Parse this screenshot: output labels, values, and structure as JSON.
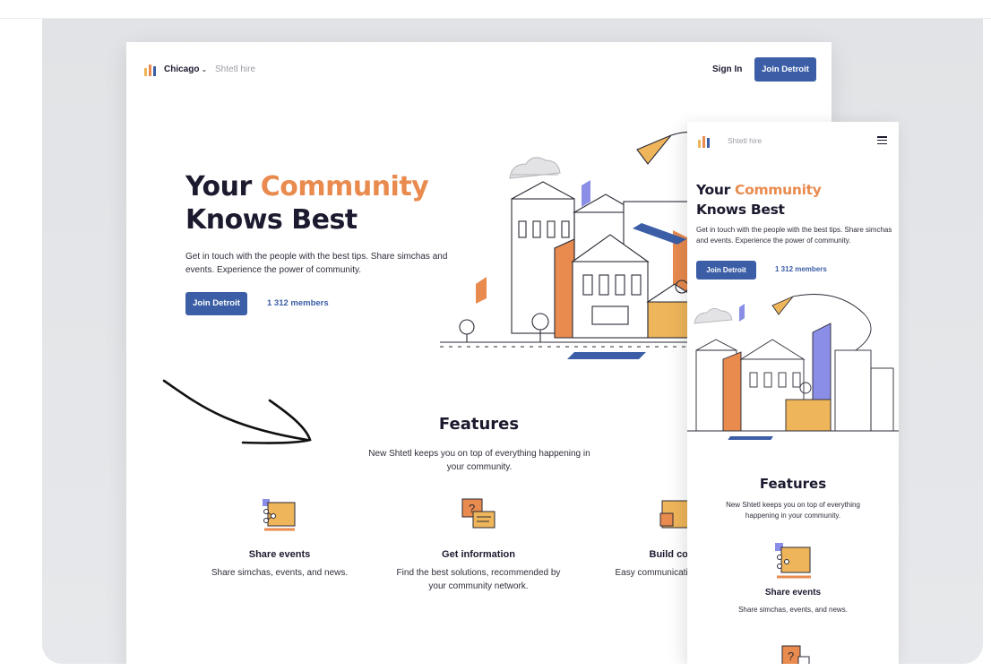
{
  "desktop": {
    "nav": {
      "city": "Chicago",
      "hire": "Shtetl hire",
      "sign_in": "Sign In",
      "join": "Join Detroit"
    },
    "hero": {
      "title_part1": "Your ",
      "title_highlight": "Community",
      "title_part2": "Knows Best",
      "subtitle": "Get in touch with the people with the best tips. Share simchas and events. Experience the power of community.",
      "join": "Join Detroit",
      "members": "1 312 members"
    },
    "features": {
      "title": "Features",
      "subtitle": "New Shtetl keeps you on top of everything happening in your community.",
      "items": [
        {
          "title": "Share events",
          "desc": "Share simchas, events, and news."
        },
        {
          "title": "Get information",
          "desc": "Find the best solutions, recommended by your community network."
        },
        {
          "title": "Build comm",
          "desc": "Easy communication t commun"
        }
      ]
    }
  },
  "mobile": {
    "hire": "Shtetl hire",
    "title_part1": "Your ",
    "title_highlight": "Community",
    "title_part2": "Knows Best",
    "subtitle": "Get in touch with the people with the best tips. Share simchas and events. Experience the power of community.",
    "join": "Join Detroit",
    "members": "1 312 members",
    "features_title": "Features",
    "features_subtitle": "New Shtetl keeps you on top of everything happening in your community.",
    "feature_title": "Share events",
    "feature_desc": "Share simchas, events, and news."
  },
  "colors": {
    "accent_orange": "#e98b4f",
    "brand_blue": "#3b5ea6",
    "text_dark": "#1b1a2e",
    "icon_purple": "#8a8ee6",
    "icon_yellow": "#efb55a"
  },
  "icons": [
    "logo-icon",
    "chevron-down-icon",
    "hamburger-menu-icon",
    "share-events-icon",
    "get-information-icon",
    "build-community-icon",
    "city-illustration",
    "hand-drawn-arrow"
  ]
}
